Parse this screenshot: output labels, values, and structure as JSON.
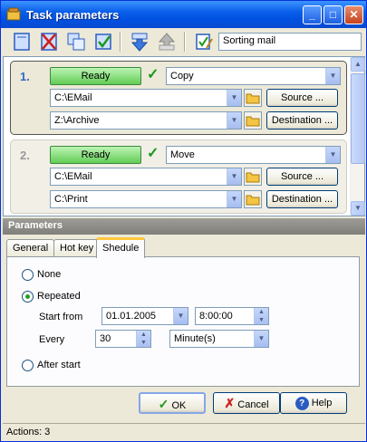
{
  "window": {
    "title": "Task parameters",
    "min_glyph": "_",
    "max_glyph": "□",
    "close_glyph": "✕"
  },
  "toolbar": {
    "task_name": "Sorting mail"
  },
  "tasks": [
    {
      "number": "1.",
      "status": "Ready",
      "action": "Copy",
      "source_path": "C:\\EMail",
      "destination_path": "Z:\\Archive",
      "source_button": "Source ...",
      "destination_button": "Destination ..."
    },
    {
      "number": "2.",
      "status": "Ready",
      "action": "Move",
      "source_path": "C:\\EMail",
      "destination_path": "C:\\Print",
      "source_button": "Source ...",
      "destination_button": "Destination ..."
    }
  ],
  "params": {
    "header": "Parameters",
    "tabs": [
      "General",
      "Hot key",
      "Shedule"
    ],
    "active_tab": "Shedule",
    "schedule": {
      "none_label": "None",
      "repeated_label": "Repeated",
      "selected": "Repeated",
      "start_from_label": "Start from",
      "start_date": "01.01.2005",
      "start_time": "8:00:00",
      "every_label": "Every",
      "every_value": "30",
      "every_unit": "Minute(s)",
      "after_start_label": "After start"
    }
  },
  "buttons": {
    "ok": "OK",
    "cancel": "Cancel",
    "help": "Help"
  },
  "status": {
    "text": "Actions: 3"
  },
  "colors": {
    "ready_green": "#62cc55",
    "title_blue": "#0a5fe9",
    "accent_number": "#316ac5"
  }
}
